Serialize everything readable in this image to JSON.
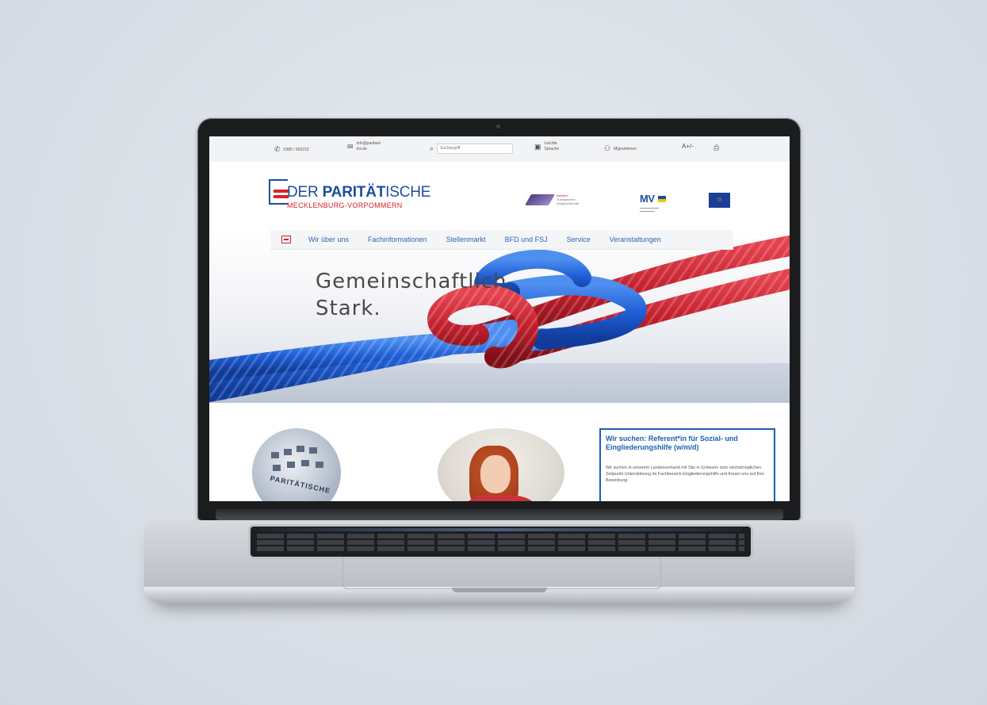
{
  "topbar": {
    "phone": "0385 / 592210",
    "email": "info@paritaet-mv.de",
    "search_placeholder": "Suchbegriff",
    "easy_language": "Leichte Sprache",
    "migrants": "Migrantinnen",
    "font_size": "A+/-",
    "icons": [
      "phone-icon",
      "mail-icon",
      "search-icon",
      "easy-language-icon",
      "people-icon",
      "font-size-icon",
      "print-icon"
    ]
  },
  "logo": {
    "name_light": "DER ",
    "name_bold": "PARITÄT",
    "name_tail": "ISCHE",
    "region": "MECKLENBURG-VORPOMMERN"
  },
  "partners": {
    "initiative_line1": "Initiative",
    "initiative_line2": "Transparente",
    "initiative_line3": "Zivilgesellschaft",
    "mv": "MV",
    "eu_label": ""
  },
  "nav": {
    "items": [
      "Wir über uns",
      "Fachinformationen",
      "Stellenmarkt",
      "BFD und FSJ",
      "Service",
      "Veranstaltungen"
    ]
  },
  "hero": {
    "line1": "Gemeinschaftlich.",
    "line2": "Stark."
  },
  "content": {
    "circle1_label": "PARITÄTISCHE",
    "job": {
      "title": "Wir suchen: Referent*in für Sozial- und Eingliederungshilfe (w/m/d)",
      "text": "Wir suchen in unserem Landesverband mit Sitz in Schwerin zum nächstmöglichen Zeitpunkt Unterstützung im Fachbereich Eingliederungshilfe und freuen uns auf Ihre Bewerbung."
    }
  },
  "colors": {
    "brand_blue": "#1b4f9c",
    "brand_red": "#d8222a",
    "nav_blue": "#2e66b5"
  }
}
